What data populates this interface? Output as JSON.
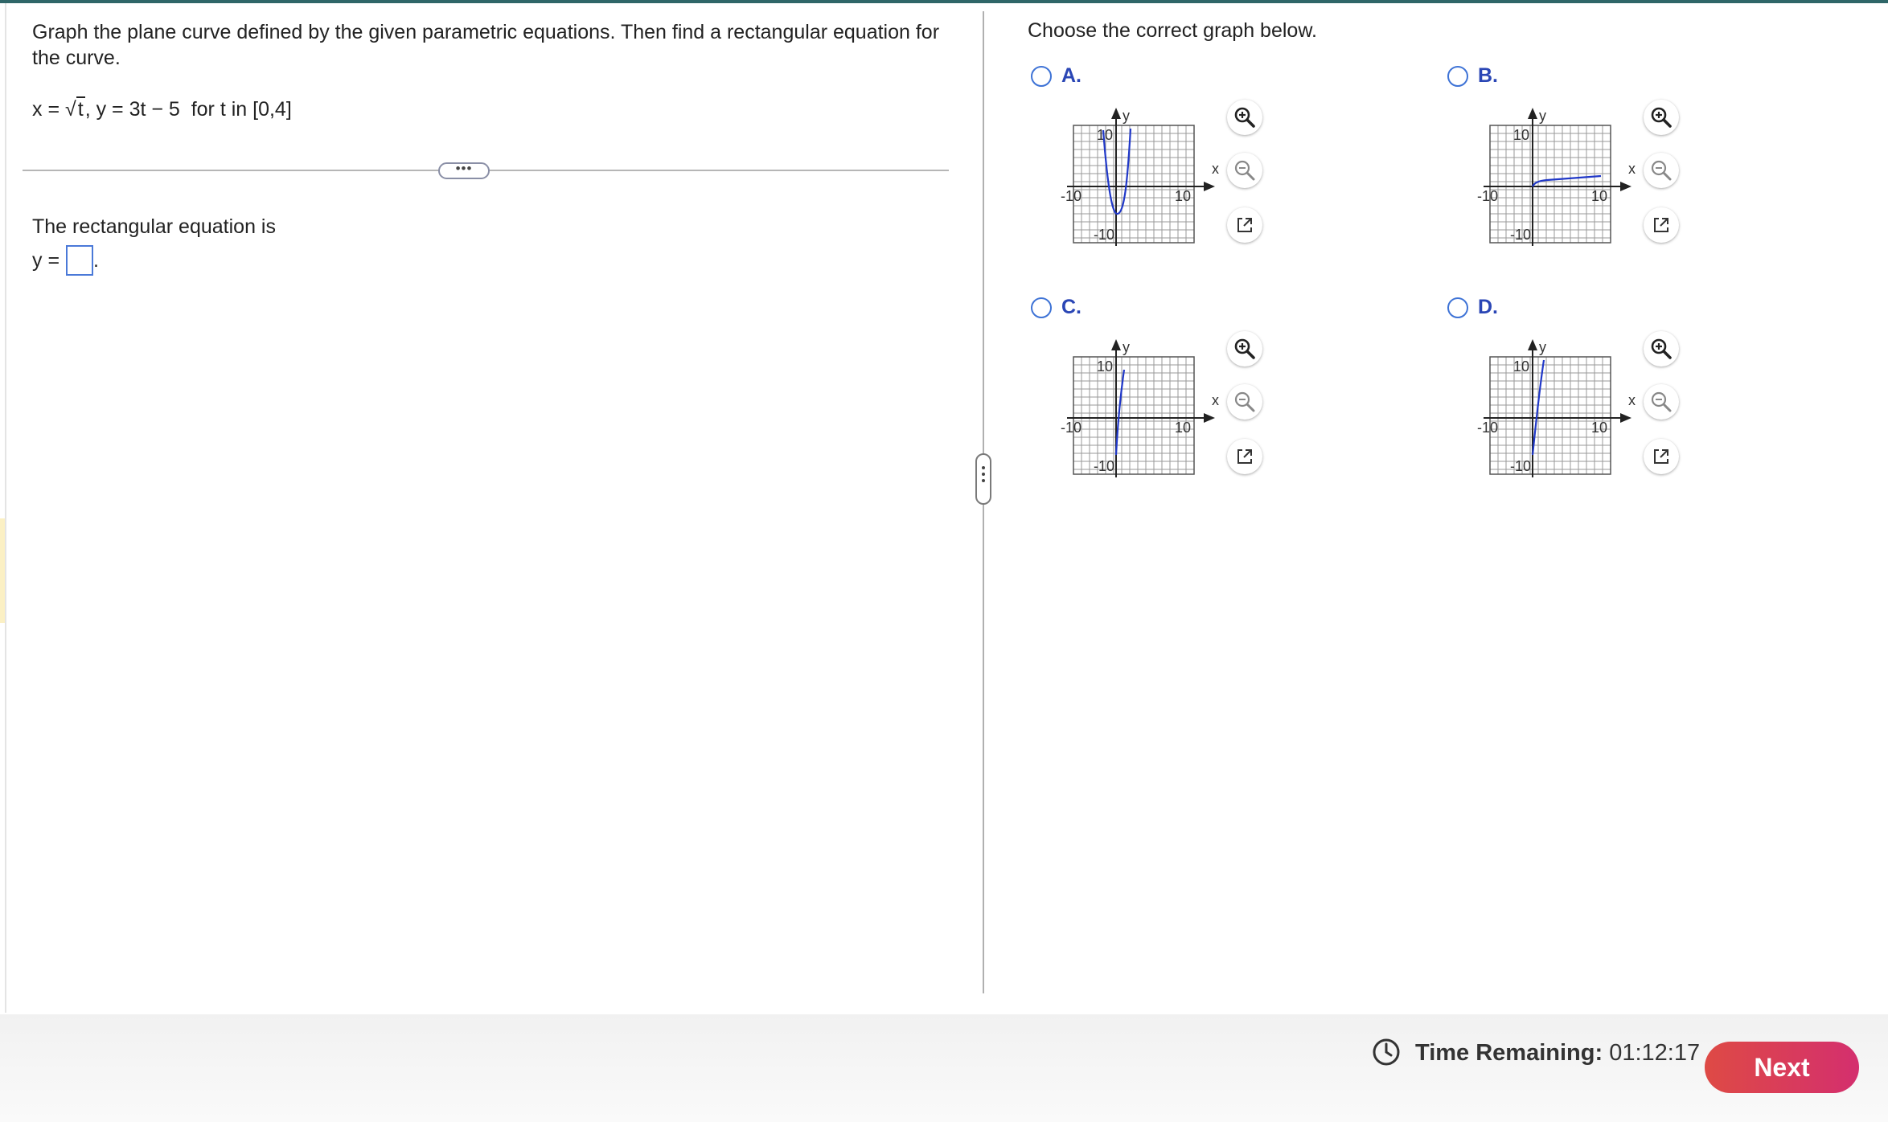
{
  "question": {
    "prompt": "Graph the plane curve defined by the given parametric equations. Then find a rectangular equation for the curve.",
    "eq_x_prefix": "x =",
    "eq_radicand": "t",
    "eq_rest": ", y = 3t − 5  for t in [0,4]",
    "rect_label": "The rectangular equation is",
    "answer_prefix": "y =",
    "answer_suffix": ".",
    "more_button": "•••"
  },
  "choices": {
    "instruction": "Choose the correct graph below.",
    "axis_x_label": "x",
    "axis_y_label": "y",
    "tick_pos": "10",
    "tick_neg": "-10",
    "options": [
      {
        "letter": "A.",
        "curve": "parabola opening up"
      },
      {
        "letter": "B.",
        "curve": "flat increasing curve"
      },
      {
        "letter": "C.",
        "curve": "steep increasing curve"
      },
      {
        "letter": "D.",
        "curve": "steep increasing curve"
      }
    ]
  },
  "footer": {
    "time_label": "Time Remaining:",
    "time_value": "01:12:17",
    "next_label": "Next"
  },
  "colors": {
    "accent_blue": "#3e73d6",
    "curve_blue": "#2038c8",
    "next_button": "#d9384f",
    "topbar": "#2f6668"
  },
  "icons": [
    "zoom-in-icon",
    "zoom-out-icon",
    "popout-icon",
    "clock-icon"
  ]
}
